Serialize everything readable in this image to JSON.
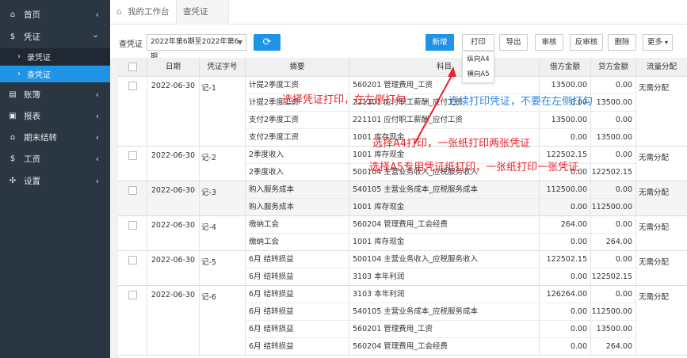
{
  "sidebar": {
    "items": [
      {
        "label": "首页",
        "icon": "home-icon",
        "glyph": "⌂",
        "chevron": "‹"
      },
      {
        "label": "凭证",
        "icon": "dollar-icon",
        "glyph": "$",
        "chevron": "⌄"
      },
      {
        "label": "录凭证",
        "arrow": "›"
      },
      {
        "label": "查凭证",
        "arrow": "›"
      },
      {
        "label": "账簿",
        "icon": "book-icon",
        "glyph": "▤",
        "chevron": "‹"
      },
      {
        "label": "报表",
        "icon": "report-icon",
        "glyph": "▣",
        "chevron": "‹"
      },
      {
        "label": "期末结转",
        "icon": "home-icon",
        "glyph": "⌂",
        "chevron": "‹"
      },
      {
        "label": "工资",
        "icon": "dollar-icon",
        "glyph": "$",
        "chevron": "‹"
      },
      {
        "label": "设置",
        "icon": "settings-icon",
        "glyph": "✣",
        "chevron": "‹"
      }
    ]
  },
  "tabs": {
    "home_icon": "⌂",
    "home": "我的工作台",
    "active": "查凭证",
    "close": "×"
  },
  "toolbar": {
    "label": "查凭证",
    "period": "2022年第6期至2022年第6期",
    "period_arrow": "▼",
    "refresh_icon": "⟳",
    "new": "新增",
    "print": "打印",
    "export": "导出",
    "audit": "审核",
    "unaudit": "反审核",
    "delete": "删除",
    "more": "更多",
    "more_arrow": "▾",
    "print_menu": [
      "纵向A4",
      "横向A5"
    ]
  },
  "table": {
    "headers": {
      "date": "日期",
      "voucher": "凭证字号",
      "summary": "摘要",
      "account": "科目",
      "debit": "借方金额",
      "credit": "贷方金额",
      "flow": "流量分配"
    },
    "groups": [
      {
        "date": "2022-06-30",
        "voucher": "记-1",
        "flow": "无需分配",
        "lines": [
          {
            "summary": "计提2季度工资",
            "account": "560201 管理费用_工资",
            "debit": "13500.00",
            "credit": "0.00"
          },
          {
            "summary": "计提2季度工资",
            "account": "221101 应付职工薪酬_应付工资",
            "debit": "0.00",
            "credit": "13500.00"
          },
          {
            "summary": "支付2季度工资",
            "account": "221101 应付职工薪酬_应付工资",
            "debit": "13500.00",
            "credit": "0.00"
          },
          {
            "summary": "支付2季度工资",
            "account": "1001 库存现金",
            "debit": "0.00",
            "credit": "13500.00"
          }
        ]
      },
      {
        "date": "2022-06-30",
        "voucher": "记-2",
        "flow": "无需分配",
        "lines": [
          {
            "summary": "2季度收入",
            "account": "1001 库存现金",
            "debit": "122502.15",
            "credit": "0.00"
          },
          {
            "summary": "2季度收入",
            "account": "500104 主营业务收入_应税服务收入",
            "debit": "0.00",
            "credit": "122502.15"
          }
        ]
      },
      {
        "date": "2022-06-30",
        "voucher": "记-3",
        "flow": "无需分配",
        "lines": [
          {
            "summary": "购入服务成本",
            "account": "540105 主营业务成本_应税服务成本",
            "debit": "112500.00",
            "credit": "0.00"
          },
          {
            "summary": "购入服务成本",
            "account": "1001 库存现金",
            "debit": "0.00",
            "credit": "112500.00"
          }
        ]
      },
      {
        "date": "2022-06-30",
        "voucher": "记-4",
        "flow": "无需分配",
        "lines": [
          {
            "summary": "缴纳工会",
            "account": "560204 管理费用_工会经费",
            "debit": "264.00",
            "credit": "0.00"
          },
          {
            "summary": "缴纳工会",
            "account": "1001 库存现金",
            "debit": "0.00",
            "credit": "264.00"
          }
        ]
      },
      {
        "date": "2022-06-30",
        "voucher": "记-5",
        "flow": "无需分配",
        "lines": [
          {
            "summary": "6月 结转损益",
            "account": "500104 主营业务收入_应税服务收入",
            "debit": "122502.15",
            "credit": "0.00"
          },
          {
            "summary": "6月 结转损益",
            "account": "3103 本年利润",
            "debit": "0.00",
            "credit": "122502.15"
          }
        ]
      },
      {
        "date": "2022-06-30",
        "voucher": "记-6",
        "flow": "无需分配",
        "lines": [
          {
            "summary": "6月 结转损益",
            "account": "3103 本年利润",
            "debit": "126264.00",
            "credit": "0.00"
          },
          {
            "summary": "6月 结转损益",
            "account": "540105 主营业务成本_应税服务成本",
            "debit": "0.00",
            "credit": "112500.00"
          },
          {
            "summary": "6月 结转损益",
            "account": "560201 管理费用_工资",
            "debit": "0.00",
            "credit": "13500.00"
          },
          {
            "summary": "6月 结转损益",
            "account": "560204 管理费用_工会经费",
            "debit": "0.00",
            "credit": "264.00"
          }
        ]
      }
    ]
  },
  "annotations": {
    "a1": "选择凭证打印，在左侧打勾",
    "a2": "连续打印凭证，不要在左侧打勾",
    "a3": "选择A4打印，一张纸打印两张凭证",
    "a4": "选择A5专用凭证纸打印，一张纸打印一张凭证"
  },
  "colors": {
    "sidebar": "#2b3643",
    "accent": "#1f93e6",
    "annotation_red": "#e6242a",
    "annotation_blue": "#2a8be0"
  }
}
